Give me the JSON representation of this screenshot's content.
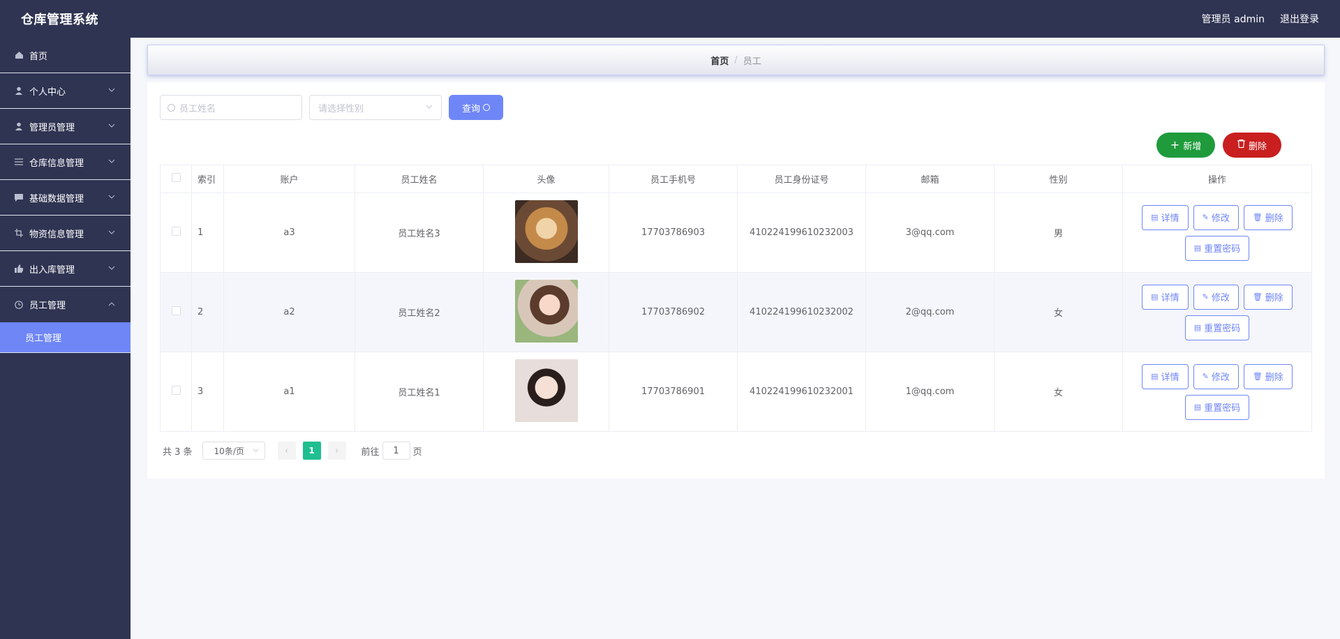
{
  "app": {
    "title": "仓库管理系统"
  },
  "header": {
    "user_label": "管理员 admin",
    "logout_label": "退出登录"
  },
  "sidebar": {
    "items": [
      {
        "label": "首页",
        "icon": "home-icon",
        "has_children": false
      },
      {
        "label": "个人中心",
        "icon": "user-icon",
        "has_children": true
      },
      {
        "label": "管理员管理",
        "icon": "user-icon",
        "has_children": true
      },
      {
        "label": "仓库信息管理",
        "icon": "list-icon",
        "has_children": true
      },
      {
        "label": "基础数据管理",
        "icon": "chat-icon",
        "has_children": true
      },
      {
        "label": "物资信息管理",
        "icon": "crop-icon",
        "has_children": true
      },
      {
        "label": "出入库管理",
        "icon": "thumb-icon",
        "has_children": true
      },
      {
        "label": "员工管理",
        "icon": "clock-icon",
        "has_children": true,
        "expanded": true
      }
    ],
    "active_sub": "员工管理"
  },
  "breadcrumb": {
    "home": "首页",
    "separator": "/",
    "current": "员工"
  },
  "search": {
    "name_placeholder": "员工姓名",
    "gender_placeholder": "请选择性别",
    "query_label": "查询"
  },
  "actions": {
    "add_label": "新增",
    "delete_label": "删除"
  },
  "table": {
    "headers": [
      "索引",
      "账户",
      "员工姓名",
      "头像",
      "员工手机号",
      "员工身份证号",
      "邮箱",
      "性别",
      "操作"
    ],
    "rows": [
      {
        "index": "1",
        "account": "a3",
        "name": "员工姓名3",
        "phone": "17703786903",
        "id_number": "410224199610232003",
        "email": "3@qq.com",
        "gender": "男"
      },
      {
        "index": "2",
        "account": "a2",
        "name": "员工姓名2",
        "phone": "17703786902",
        "id_number": "410224199610232002",
        "email": "2@qq.com",
        "gender": "女"
      },
      {
        "index": "3",
        "account": "a1",
        "name": "员工姓名1",
        "phone": "17703786901",
        "id_number": "410224199610232001",
        "email": "1@qq.com",
        "gender": "女"
      }
    ],
    "row_ops": {
      "detail": "详情",
      "edit": "修改",
      "delete": "删除",
      "reset": "重置密码"
    }
  },
  "pagination": {
    "total_text": "共 3 条",
    "page_size": "10条/页",
    "current_page": "1",
    "goto_prefix": "前往",
    "goto_value": "1",
    "goto_suffix": "页"
  },
  "colors": {
    "header_bg": "#2f3452",
    "accent": "#6f86f7",
    "add": "#1f9b3c",
    "danger": "#c91f1f",
    "page_active": "#1fbf91"
  }
}
